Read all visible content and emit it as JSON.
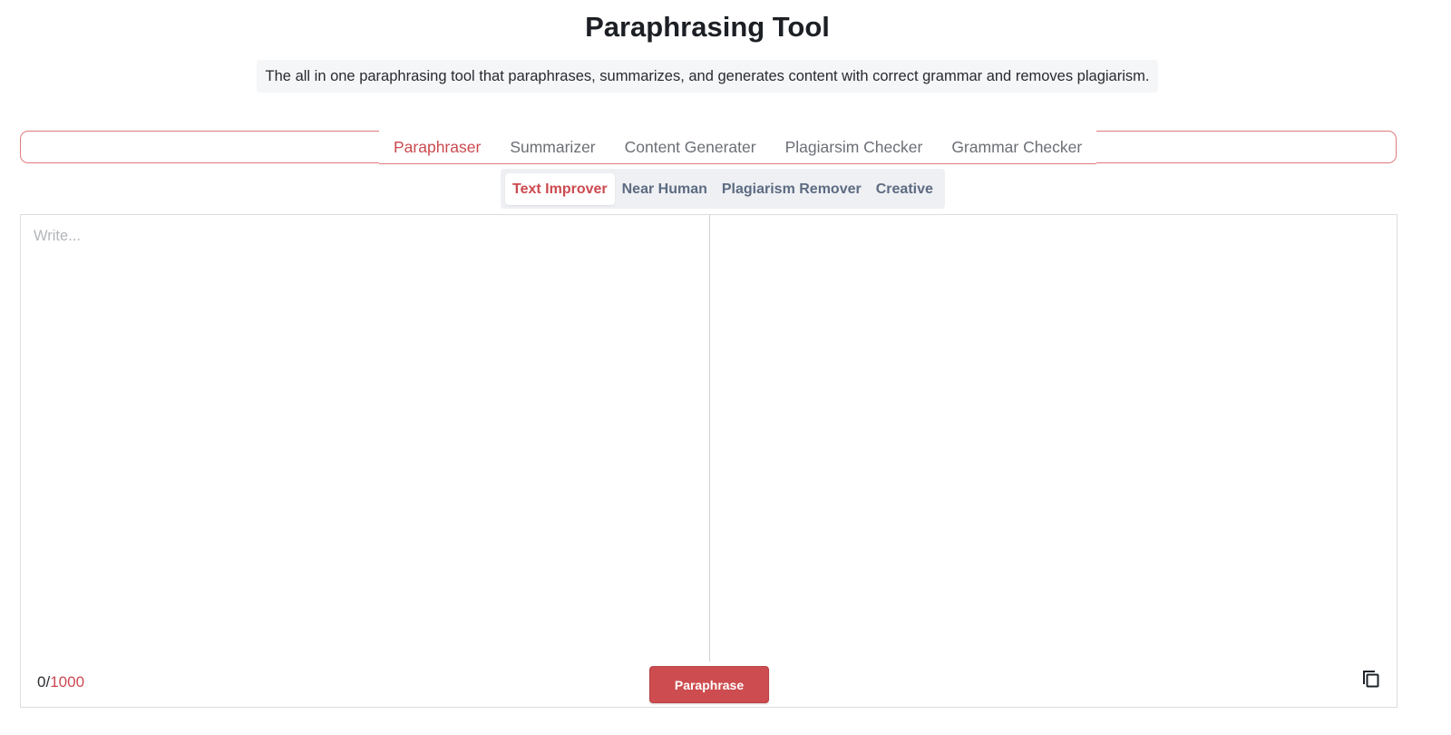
{
  "header": {
    "title": "Paraphrasing Tool",
    "subtitle": "The all in one paraphrasing tool that paraphrases, summarizes, and generates content with correct grammar and removes plagiarism."
  },
  "tabs": [
    {
      "label": "Paraphraser",
      "active": true
    },
    {
      "label": "Summarizer",
      "active": false
    },
    {
      "label": "Content Generater",
      "active": false
    },
    {
      "label": "Plagiarsim Checker",
      "active": false
    },
    {
      "label": "Grammar Checker",
      "active": false
    }
  ],
  "modes": [
    {
      "label": "Text Improver",
      "active": true
    },
    {
      "label": "Near Human",
      "active": false
    },
    {
      "label": "Plagiarism Remover",
      "active": false
    },
    {
      "label": "Creative",
      "active": false
    }
  ],
  "editor": {
    "input_placeholder": "Write...",
    "input_value": "",
    "char_count": "0",
    "char_separator": "/",
    "char_limit": "1000",
    "output_text": ""
  },
  "actions": {
    "paraphrase_label": "Paraphrase",
    "copy_icon": "copy-icon"
  },
  "colors": {
    "accent": "#cd4c4f",
    "tab_border": "#e07a7e",
    "mode_bg": "#eef0f3",
    "mode_text": "#5d6b82"
  }
}
